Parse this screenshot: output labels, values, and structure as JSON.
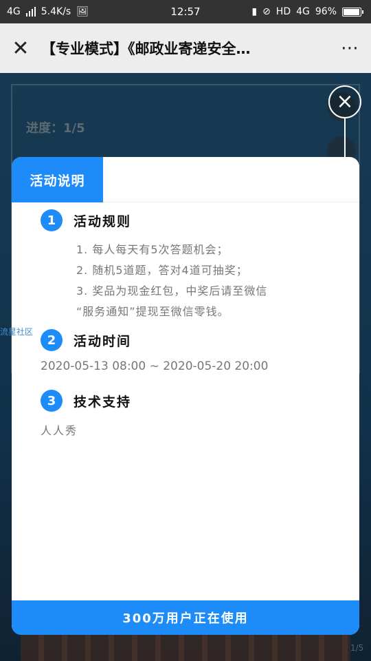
{
  "status_bar": {
    "network": "4G",
    "speed": "5.4K/s",
    "time": "12:57",
    "net_type": "HD",
    "net_gen": "4G",
    "battery": "96%"
  },
  "nav": {
    "close_icon": "close-icon",
    "title": "【专业模式】《邮政业寄递安全…",
    "more_icon": "more-icon"
  },
  "background": {
    "progress": "进度：1/5",
    "page_counter": "1/5",
    "watermark": "流星社区"
  },
  "modal": {
    "tab": "活动说明",
    "sections": [
      {
        "num": "1",
        "title": "活动规则",
        "rules": [
          "1. 每人每天有5次答题机会；",
          "2. 随机5道题，答对4道可抽奖；",
          "3. 奖品为现金红包，中奖后请至微信",
          "“服务通知”提现至微信零钱。"
        ]
      },
      {
        "num": "2",
        "title": "活动时间",
        "body": "2020-05-13 08:00 ~ 2020-05-20 20:00"
      },
      {
        "num": "3",
        "title": "技术支持",
        "body": "人人秀"
      }
    ],
    "footer": "300万用户正在使用"
  },
  "colors": {
    "accent": "#1d8cf8",
    "navbar_bg": "#ededed",
    "statusbar_bg": "#333333"
  }
}
